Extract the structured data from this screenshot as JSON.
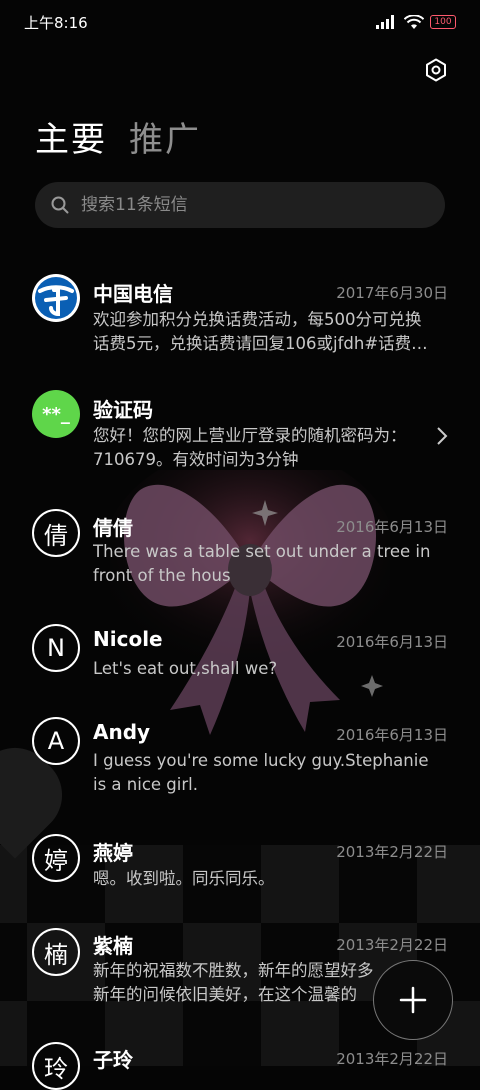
{
  "status_bar": {
    "time": "上午8:16",
    "battery": "100"
  },
  "tabs": [
    {
      "label": "主要"
    },
    {
      "label": "推广"
    }
  ],
  "search": {
    "placeholder": "搜索11条短信"
  },
  "conversations": [
    {
      "name": "中国电信",
      "date": "2017年6月30日",
      "preview_line1": "欢迎参加积分兑换话费活动，每500分可兑换",
      "preview_line2": "话费5元，兑换话费请回复106或jfdh#话费…"
    },
    {
      "name": "验证码",
      "avatar_text": "**_",
      "preview_line1": "您好！您的网上营业厅登录的随机密码为：",
      "preview_line2": "710679。有效时间为3分钟"
    },
    {
      "name": "倩倩",
      "avatar_text": "倩",
      "date": "2016年6月13日",
      "preview_line1": "There was a table set out under a tree in",
      "preview_line2": "front of the hous"
    },
    {
      "name": "Nicole",
      "avatar_text": "N",
      "date": "2016年6月13日",
      "preview_line1": "Let's eat out,shall we?"
    },
    {
      "name": "Andy",
      "avatar_text": "A",
      "date": "2016年6月13日",
      "preview_line1": "I guess you're some lucky guy.Stephanie",
      "preview_line2": "is a nice girl."
    },
    {
      "name": "燕婷",
      "avatar_text": "婷",
      "date": "2013年2月22日",
      "preview_line1": "嗯。收到啦。同乐同乐。"
    },
    {
      "name": "紫楠",
      "avatar_text": "楠",
      "date": "2013年2月22日",
      "preview_line1": "新年的祝福数不胜数，新年的愿望好多",
      "preview_line2": "新年的问候依旧美好，在这个温馨的"
    },
    {
      "name": "子玲",
      "avatar_text": "玲",
      "date": "2013年2月22日"
    }
  ],
  "colors": {
    "verification_avatar": "#5fd64a",
    "telecom_blue": "#0a5fb4",
    "battery": "#ff5a6e"
  }
}
